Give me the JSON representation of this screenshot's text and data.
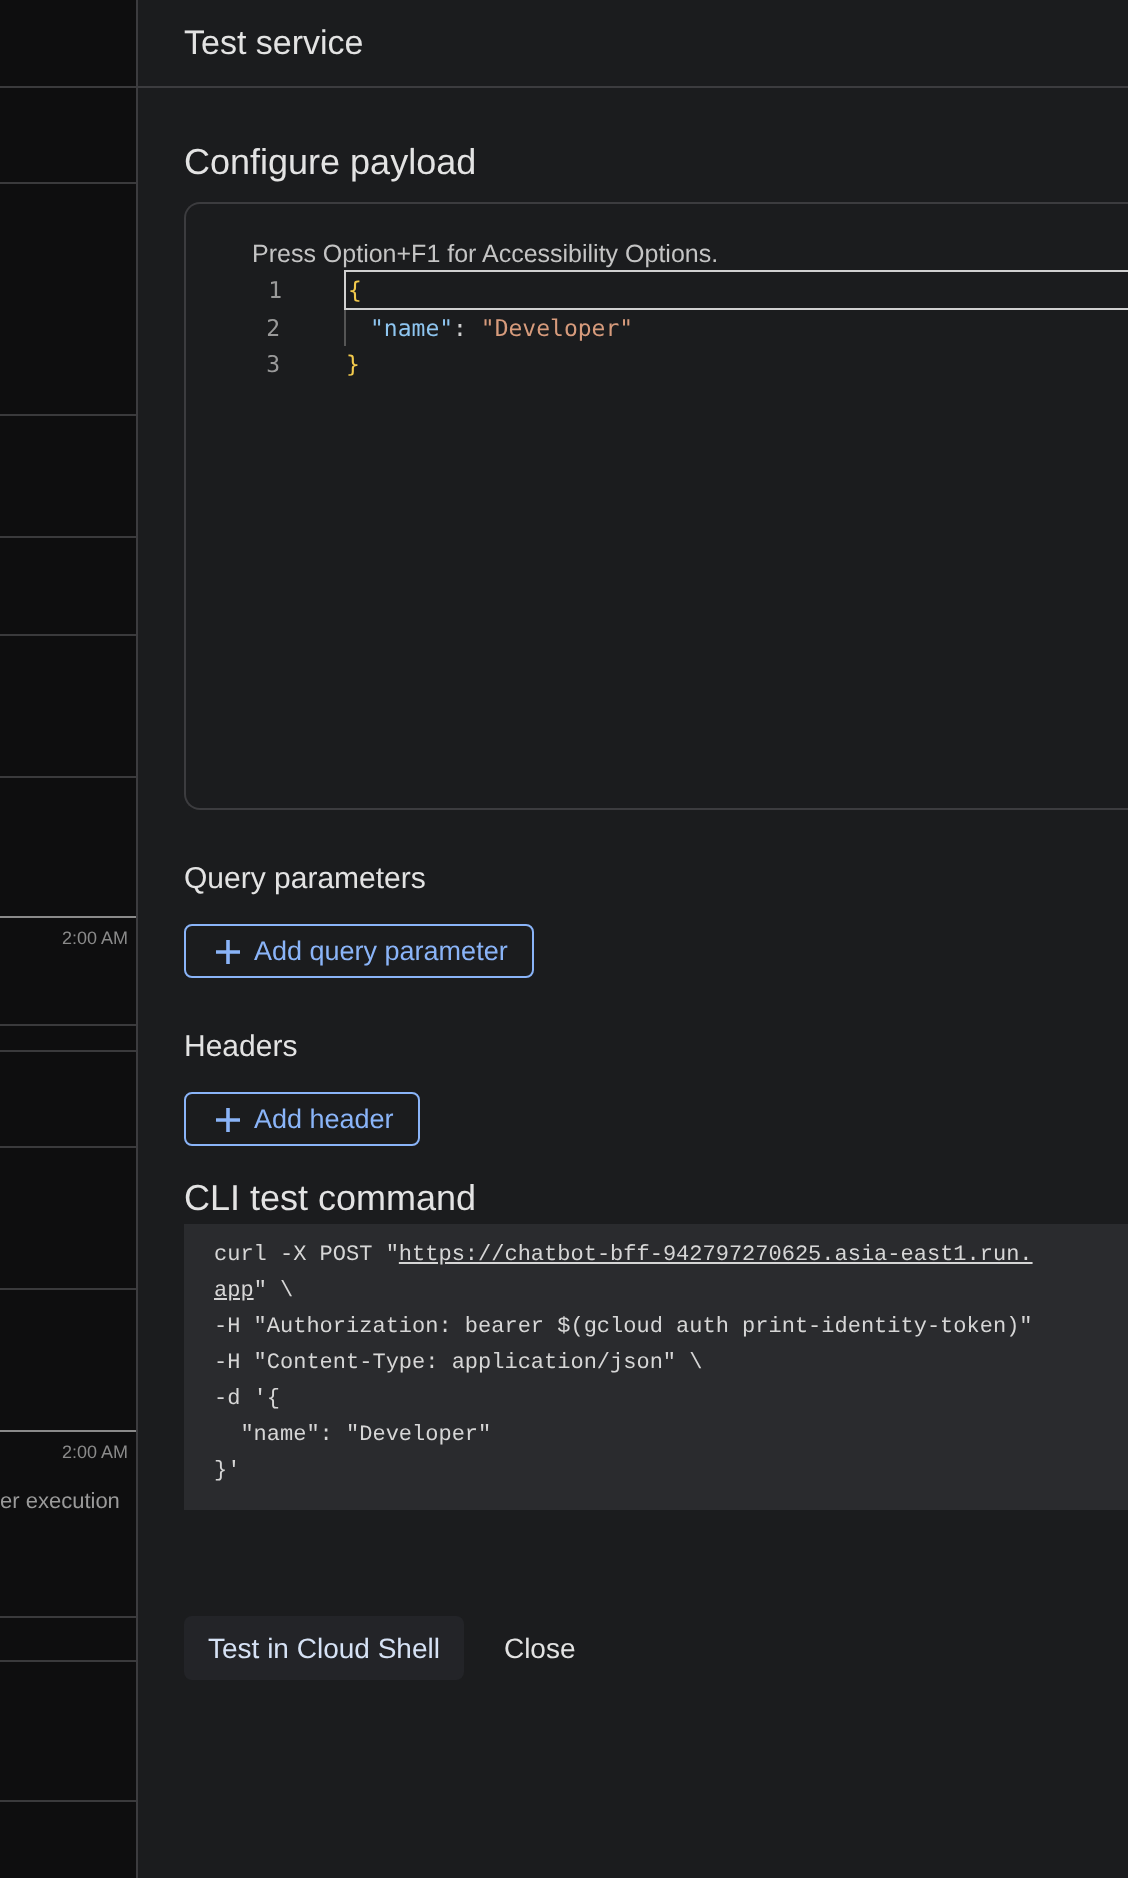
{
  "background": {
    "axis_labels": [
      "2:00 AM",
      "2:00 AM"
    ],
    "caption": "er execution"
  },
  "panel": {
    "title": "Test service",
    "payload": {
      "heading": "Configure payload",
      "hint": "Press Option+F1 for Accessibility Options.",
      "lines": [
        {
          "number": "1",
          "tokens": [
            {
              "kind": "brace",
              "text": "{"
            }
          ]
        },
        {
          "number": "2",
          "tokens": [
            {
              "kind": "key",
              "text": "\"name\""
            },
            {
              "kind": "punct",
              "text": ": "
            },
            {
              "kind": "string",
              "text": "\"Developer\""
            }
          ]
        },
        {
          "number": "3",
          "tokens": [
            {
              "kind": "brace",
              "text": "}"
            }
          ]
        }
      ]
    },
    "query": {
      "heading": "Query parameters",
      "button": "Add query parameter"
    },
    "headers": {
      "heading": "Headers",
      "button": "Add header"
    },
    "cli": {
      "heading": "CLI test command",
      "lines": [
        {
          "pre": "curl -X POST \"",
          "link": "https://chatbot-bff-942797270625.asia-east1.run."
        },
        {
          "link": "app",
          "post": "\" \\"
        },
        {
          "pre": "-H \"Authorization: bearer $(gcloud auth print-identity-token)\""
        },
        {
          "pre": "-H \"Content-Type: application/json\" \\"
        },
        {
          "pre": "-d '{"
        },
        {
          "pre": "  \"name\": \"Developer\""
        },
        {
          "pre": "}'"
        }
      ]
    },
    "actions": [
      {
        "kind": "filled",
        "label": "Test in Cloud Shell"
      },
      {
        "kind": "text",
        "label": "Close"
      }
    ]
  }
}
